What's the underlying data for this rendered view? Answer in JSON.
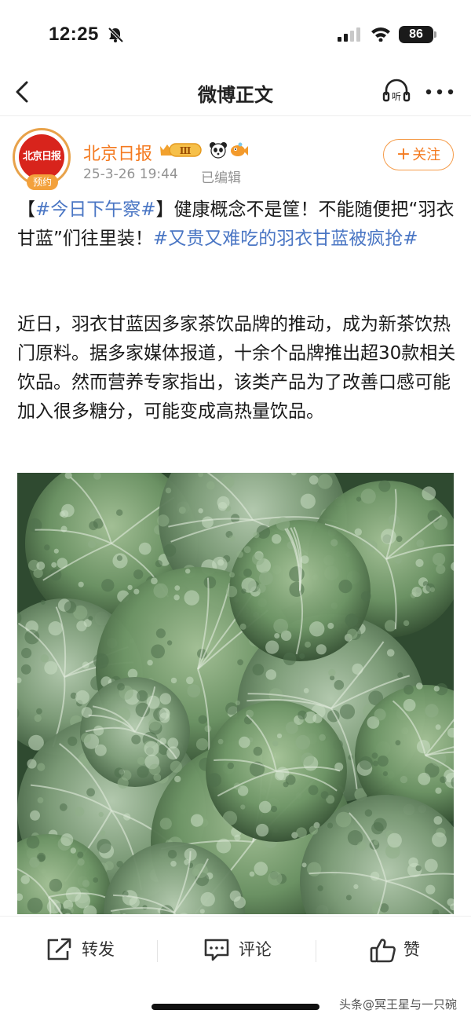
{
  "status_bar": {
    "time": "12:25",
    "battery": "86"
  },
  "nav": {
    "title": "微博正文",
    "back_icon": "chevron-left-icon",
    "listen_icon": "listen-icon",
    "more_icon": "more-dots-icon"
  },
  "author": {
    "avatar_text": "北京日报",
    "avatar_badge": "预约",
    "name": "北京日报",
    "vip_level": "Ⅲ",
    "time": "25-3-26 19:44",
    "edited": "已编辑",
    "follow_label": "关注",
    "follow_plus": "+"
  },
  "post": {
    "headline": {
      "bracket_open": "【",
      "topic1": "#今日下午察#",
      "bracket_close": "】",
      "text1": "健康概念不是筐！不能随便把“羽衣甘蓝”们往里装！",
      "topic2": "#又贵又难吃的羽衣甘蓝被疯抢#"
    },
    "paragraph": "近日，羽衣甘蓝因多家茶饮品牌的推动，成为新茶饮热门原料。据多家媒体报道，十余个品牌推出超30款相关饮品。然而营养专家指出，该类产品为了改善口感可能加入很多糖分，可能变成高热量饮品。"
  },
  "actions": {
    "repost": "转发",
    "comment": "评论",
    "like": "赞"
  },
  "watermark": "头条@冥王星与一只碗",
  "colors": {
    "accent": "#f47a20",
    "topic": "#4a76c4",
    "text": "#1a1a1a",
    "muted": "#939393"
  }
}
